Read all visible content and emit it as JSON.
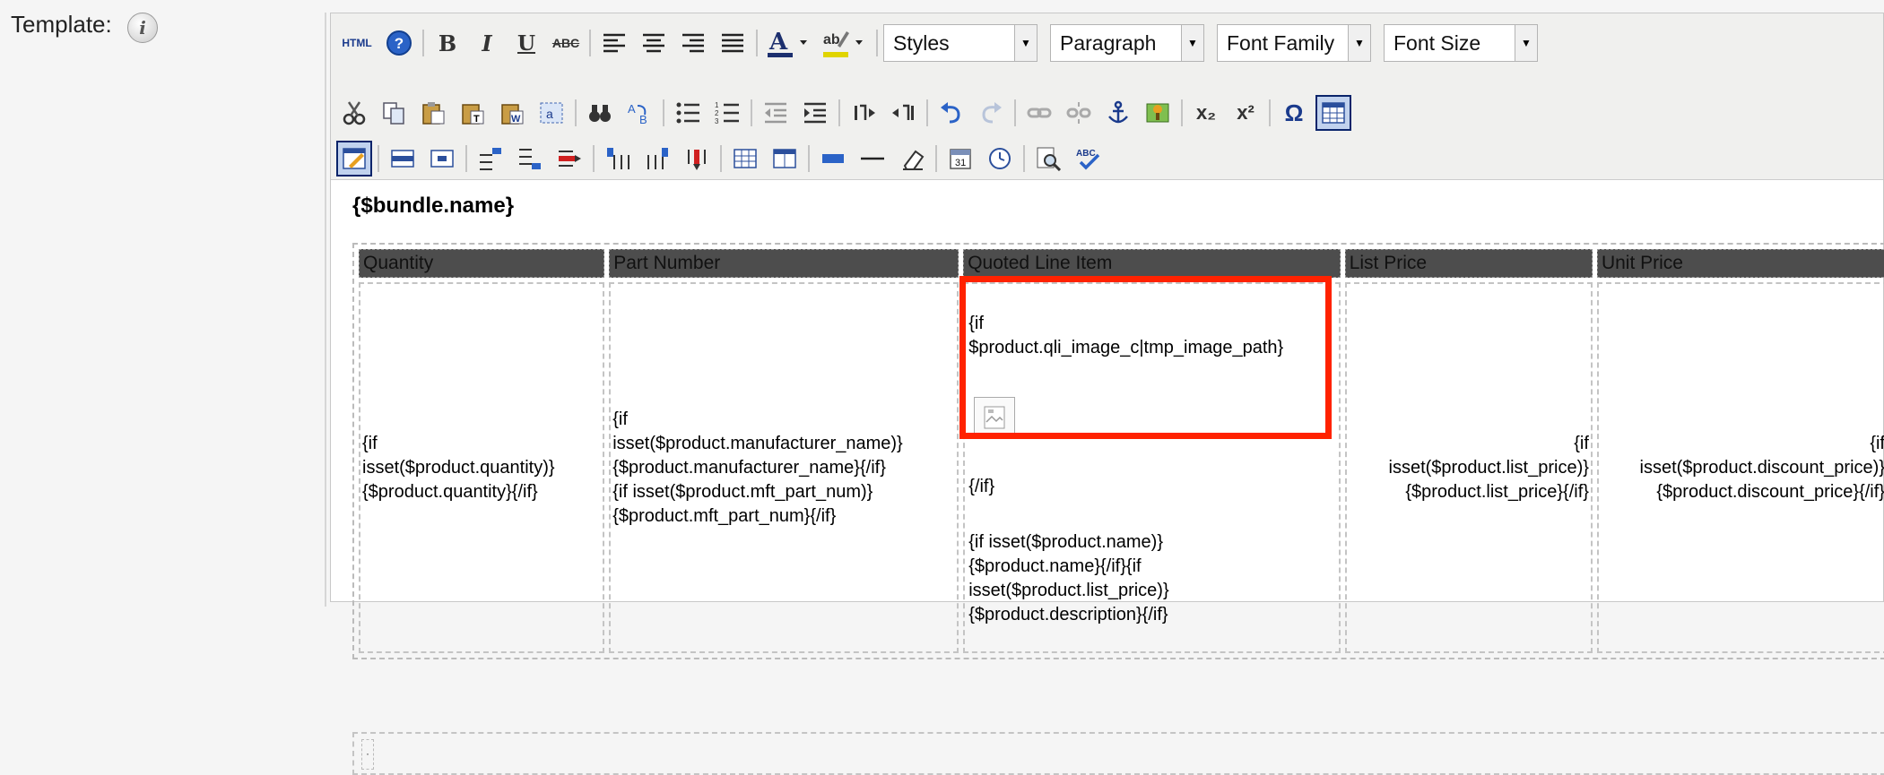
{
  "form": {
    "label": "Template:",
    "info_icon": "info-icon"
  },
  "toolbar": {
    "row1": {
      "html_label": "HTML",
      "help_label": "?",
      "bold_label": "B",
      "italic_label": "I",
      "underline_label": "U",
      "strike_label": "ABC",
      "selects": {
        "styles": "Styles",
        "paragraph": "Paragraph",
        "font_family": "Font Family",
        "font_size": "Font Size"
      }
    },
    "row2": {
      "subscript_label": "x₂",
      "superscript_label": "x²",
      "omega_label": "Ω"
    }
  },
  "editor": {
    "bundle_name": "{$bundle.name}",
    "table": {
      "headers": [
        "Quantity",
        "Part Number",
        "Quoted Line Item",
        "List Price",
        "Unit Price"
      ],
      "cells": {
        "quantity": "{if\nisset($product.quantity)}\n{$product.quantity}{/if}",
        "part_number": "{if\nisset($product.manufacturer_name)}\n{$product.manufacturer_name}{/if}\n{if isset($product.mft_part_num)}\n{$product.mft_part_num}{/if}",
        "qli_top": "{if\n$product.qli_image_c|tmp_image_path}",
        "qli_end": "{/if}",
        "qli_bottom": "{if isset($product.name)}\n{$product.name}{/if}{if\nisset($product.list_price)}\n{$product.description}{/if}",
        "list_price": "{if\nisset($product.list_price)}\n{$product.list_price}{/if}",
        "unit_price": "{if\nisset($product.discount_price)}\n{$product.discount_price}{/if}"
      }
    },
    "empty_row_marker": "·"
  }
}
